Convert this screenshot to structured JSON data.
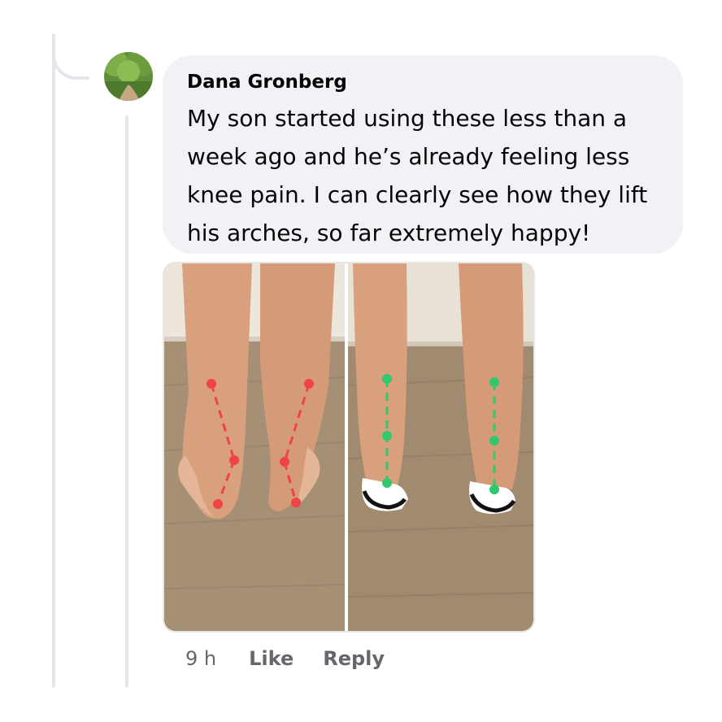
{
  "comment": {
    "author": "Dana Gronberg",
    "text": "My son started using these less than a week ago and he’s already feeling less knee pain. I can clearly see how they lift his arches, so far extremely happy!",
    "lines": [
      "My son started using these less than a",
      "week ago and he’s already feeling less",
      "knee pain. I can clearly see how they lift",
      "his arches, so far extremely happy!"
    ],
    "time": "9 h",
    "like_label": "Like",
    "reply_label": "Reply"
  },
  "attachment": {
    "type": "photo",
    "description_colors": {
      "before_marker": "#ef4444",
      "after_marker": "#34c76f"
    }
  },
  "colors": {
    "bubble_bg": "#f0f2f5",
    "text": "#050505",
    "muted_text": "#65676b",
    "thread_line": "#e4e6eb"
  }
}
